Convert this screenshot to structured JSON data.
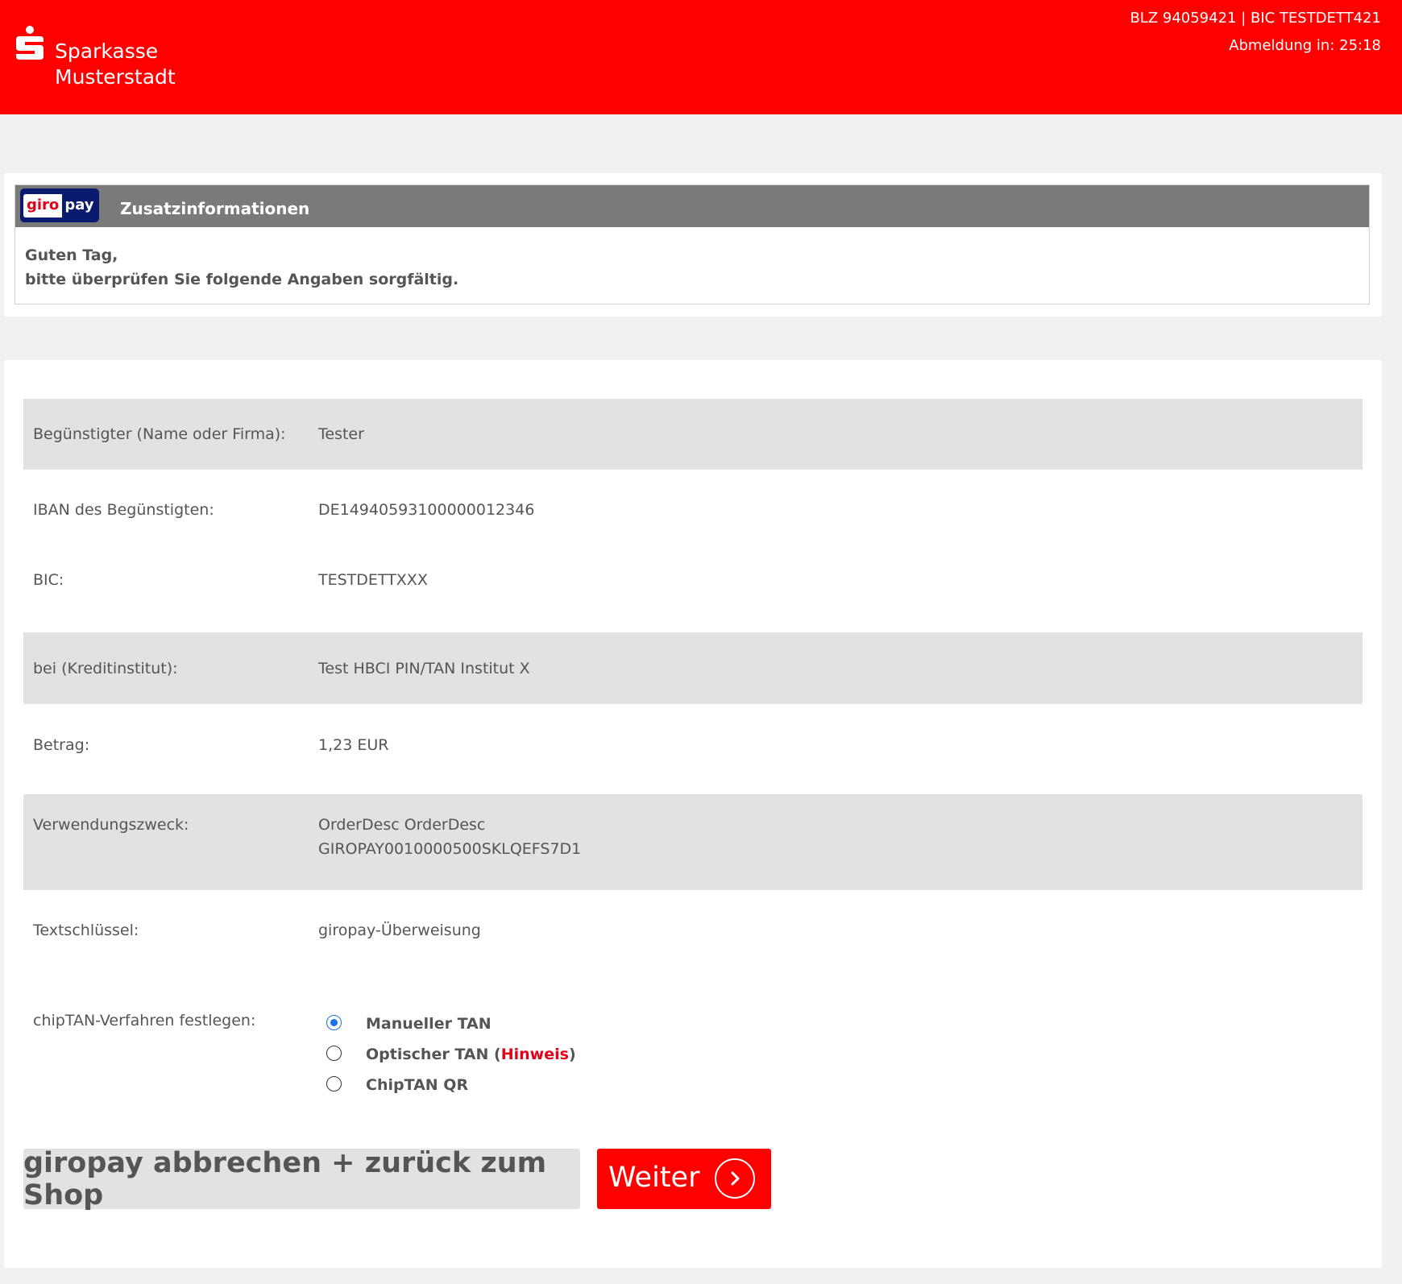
{
  "header": {
    "bank_line1": "Sparkasse",
    "bank_line2": "Musterstadt",
    "bank_ids": "BLZ 94059421 | BIC TESTDETT421",
    "logout_timer": "Abmeldung in: 25:18",
    "logo_icon": "sparkasse-s-icon"
  },
  "info": {
    "badge_giro": "giro",
    "badge_pay": "pay",
    "title": "Zusatzinformationen",
    "greeting": "Guten Tag,",
    "message": "bitte überprüfen Sie folgende Angaben sorgfältig."
  },
  "details": [
    {
      "label": "Begünstigter (Name oder Firma):",
      "value": "Tester"
    },
    {
      "label": "IBAN des Begünstigten:",
      "value": "DE14940593100000012346"
    },
    {
      "label": "BIC:",
      "value": "TESTDETTXXX"
    },
    {
      "label": "bei (Kreditinstitut):",
      "value": "Test HBCI PIN/TAN Institut X"
    },
    {
      "label": "Betrag:",
      "value": "1,23 EUR"
    },
    {
      "label": "Verwendungszweck:",
      "value": "OrderDesc OrderDesc",
      "value2": "GIROPAY0010000500SKLQEFS7D1"
    },
    {
      "label": "Textschlüssel:",
      "value": "giropay-Überweisung"
    }
  ],
  "tan": {
    "label": "chipTAN-Verfahren festlegen:",
    "options": [
      {
        "label": "Manueller TAN",
        "checked": true
      },
      {
        "label": "Optischer TAN",
        "open": " (",
        "hint": "Hinweis",
        "close": ")",
        "checked": false
      },
      {
        "label": "ChipTAN QR",
        "checked": false
      }
    ]
  },
  "buttons": {
    "cancel": "giropay abbrechen + zurück zum Shop",
    "next": "Weiter",
    "next_icon": "chevron-right-icon"
  },
  "colors": {
    "brand_red": "#ff0000",
    "panel_grey": "#7a7a7a",
    "row_shade": "#e2e2e2",
    "radio_blue": "#1a73e8"
  }
}
